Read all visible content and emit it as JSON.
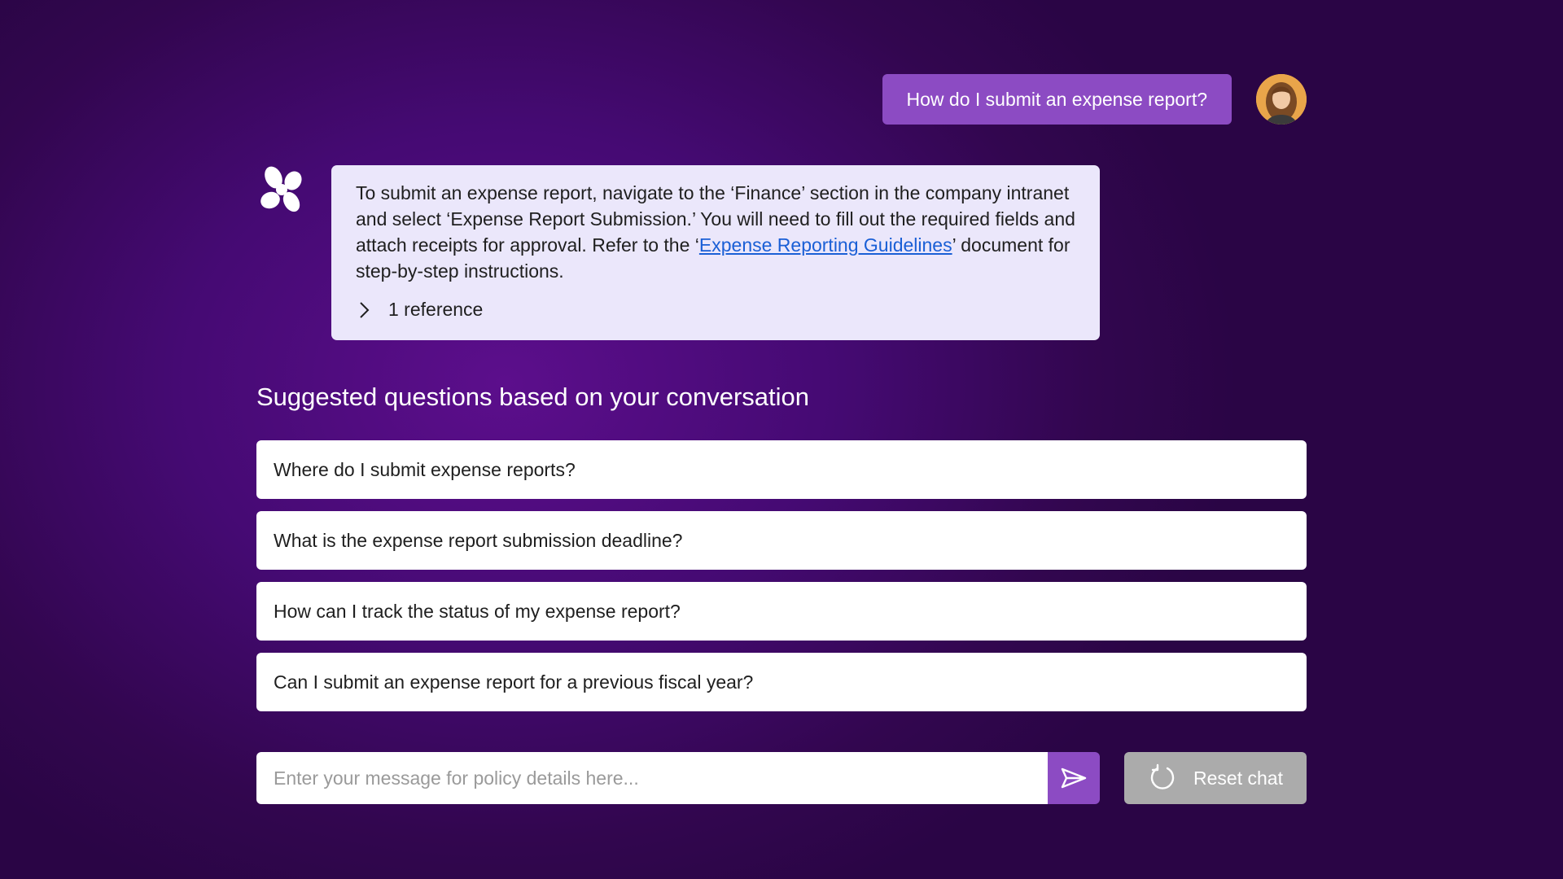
{
  "conversation": {
    "user_message": "How do I submit an expense report?",
    "bot_response": {
      "text_before_link": "To submit an expense report, navigate to the ‘Finance’ section in the company intranet and select ‘Expense Report Submission.’ You will need to fill out the required fields and attach receipts for approval. Refer to the ‘",
      "link_text": "Expense Reporting Guidelines",
      "text_after_link": "’ document for step-by-step instructions.",
      "references_label": "1 reference"
    }
  },
  "suggestions": {
    "title": "Suggested questions based on your conversation",
    "items": [
      "Where do I submit expense reports?",
      "What is the expense report submission deadline?",
      "How can I track the status of my expense report?",
      "Can I submit an expense report for a previous fiscal year?"
    ]
  },
  "composer": {
    "placeholder": "Enter your message for policy details here...",
    "send_icon": "send-icon",
    "reset_label": "Reset chat",
    "reset_icon": "refresh-icon"
  },
  "colors": {
    "accent": "#8c4bc3",
    "bot_bubble": "#ebe7fb",
    "link": "#1a5fd6",
    "reset_button": "#ababab"
  }
}
